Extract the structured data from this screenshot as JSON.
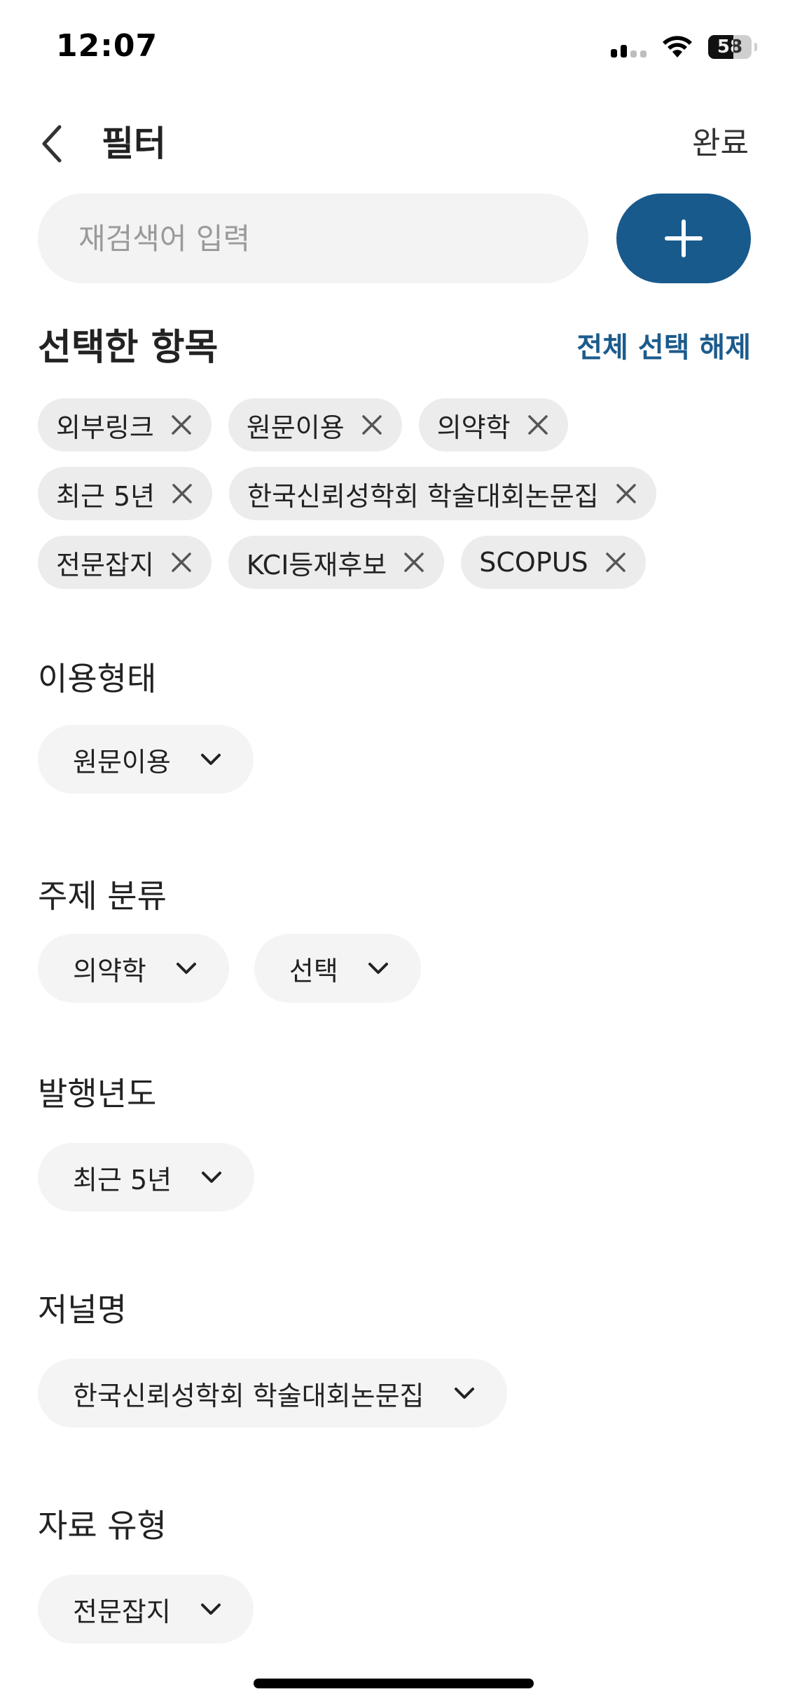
{
  "status_bar": {
    "time": "12:07",
    "battery": "58"
  },
  "header": {
    "title": "필터",
    "done_label": "완료"
  },
  "search": {
    "placeholder": "재검색어 입력",
    "value": ""
  },
  "selected": {
    "title": "선택한 항목",
    "clear_all_label": "전체 선택 해제",
    "chips": [
      [
        "외부링크",
        "원문이용",
        "의약학"
      ],
      [
        "최근 5년",
        "한국신뢰성학회 학술대회논문집"
      ],
      [
        "전문잡지",
        "KCI등재후보",
        "SCOPUS"
      ]
    ]
  },
  "filters": {
    "usage_type": {
      "label": "이용형태",
      "options": [
        "원문이용"
      ]
    },
    "subject": {
      "label": "주제 분류",
      "options": [
        "의약학",
        "선택"
      ]
    },
    "year": {
      "label": "발행년도",
      "options": [
        "최근 5년"
      ]
    },
    "journal": {
      "label": "저널명",
      "options": [
        "한국신뢰성학회 학술대회논문집"
      ]
    },
    "material_type": {
      "label": "자료 유형",
      "options": [
        "전문잡지"
      ]
    }
  },
  "colors": {
    "accent": "#185a8c",
    "link": "#1c5b8c",
    "chip_bg": "#ececec",
    "dropdown_bg": "#f4f4f4"
  }
}
